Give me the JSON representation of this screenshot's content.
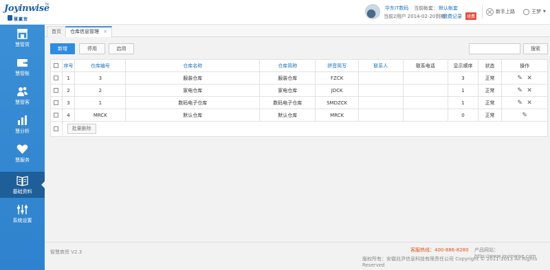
{
  "brand": {
    "logo_text": "Joyinwise",
    "logo_sub": "慧赢贸",
    "tm": "TM"
  },
  "header": {
    "shop_name": "华东IT数码",
    "account_label": "当前帐套：",
    "account_value": "默认帐套",
    "expire_text": "当前2用户 2014-02-20到期",
    "renew_link": "缴费记录",
    "renew_badge": "续费",
    "guide_label": "新手上路",
    "user_name": "王梦"
  },
  "sidebar": {
    "items": [
      {
        "label": "慧管货",
        "icon": "store-icon"
      },
      {
        "label": "慧管账",
        "icon": "wallet-icon"
      },
      {
        "label": "慧管客",
        "icon": "users-icon"
      },
      {
        "label": "慧分析",
        "icon": "bar-chart-icon"
      },
      {
        "label": "慧服务",
        "icon": "heart-icon"
      },
      {
        "label": "基础资料",
        "icon": "book-icon"
      },
      {
        "label": "系统设置",
        "icon": "sliders-icon"
      }
    ]
  },
  "tabs": {
    "home": "首页",
    "active": "仓库信息管理"
  },
  "toolbar": {
    "new_label": "新增",
    "disable_label": "停用",
    "enable_label": "启用",
    "search_placeholder": "",
    "search_label": "搜索"
  },
  "table": {
    "columns": [
      "序号",
      "仓库编号",
      "仓库名称",
      "仓库简称",
      "拼音简写",
      "联系人",
      "联系电话",
      "显示顺序",
      "状态",
      "操作"
    ],
    "rows": [
      {
        "seq": "1",
        "code": "3",
        "name": "服装仓库",
        "short": "服装仓库",
        "pinyin": "FZCK",
        "contact": "",
        "phone": "",
        "order": "3",
        "status": "正常"
      },
      {
        "seq": "2",
        "code": "2",
        "name": "家电仓库",
        "short": "家电仓库",
        "pinyin": "JDCK",
        "contact": "",
        "phone": "",
        "order": "1",
        "status": "正常"
      },
      {
        "seq": "3",
        "code": "1",
        "name": "数码电子仓库",
        "short": "数码电子仓库",
        "pinyin": "SMDZCK",
        "contact": "",
        "phone": "",
        "order": "1",
        "status": "正常"
      },
      {
        "seq": "4",
        "code": "MRCK",
        "name": "默认仓库",
        "short": "默认仓库",
        "pinyin": "MRCK",
        "contact": "",
        "phone": "",
        "order": "0",
        "status": "正常"
      }
    ],
    "bulk_delete_label": "批量删除"
  },
  "footer": {
    "version": "智慧商贸 V2.3",
    "hotline": "客服热线：400-886-8280",
    "site": "产品网站：http://www.joyinwise.com",
    "copyright": "版权所有：安徽兆尹信息科技有限责任公司 Copyright © 2011-2013 All Rights Reserved"
  },
  "colors": {
    "sidebar": "#3a8fd6",
    "sidebar_active": "#1e5f99",
    "primary_button": "#2e8ce0",
    "link": "#1d6fb8",
    "hotline": "#e0501c"
  }
}
